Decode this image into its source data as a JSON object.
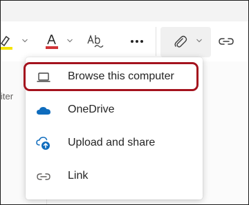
{
  "toolbar": {
    "highlight_color_hex": "#f5e400",
    "font_color_hex": "#d13438",
    "items": [
      {
        "name": "highlight-color-icon"
      },
      {
        "name": "font-color-icon"
      },
      {
        "name": "spell-check-icon"
      },
      {
        "name": "more-icon"
      },
      {
        "name": "attach-icon"
      },
      {
        "name": "link-icon"
      }
    ]
  },
  "doc": {
    "partial_text": "iter"
  },
  "menu": {
    "items": [
      {
        "label": "Browse this computer",
        "icon": "laptop-icon",
        "highlighted": true
      },
      {
        "label": "OneDrive",
        "icon": "onedrive-cloud-icon",
        "icon_color_hex": "#0f6cbd"
      },
      {
        "label": "Upload and share",
        "icon": "cloud-upload-icon",
        "icon_color_hex": "#0f6cbd"
      },
      {
        "label": "Link",
        "icon": "link-icon"
      }
    ]
  },
  "annotation_color_hex": "#a4121d"
}
